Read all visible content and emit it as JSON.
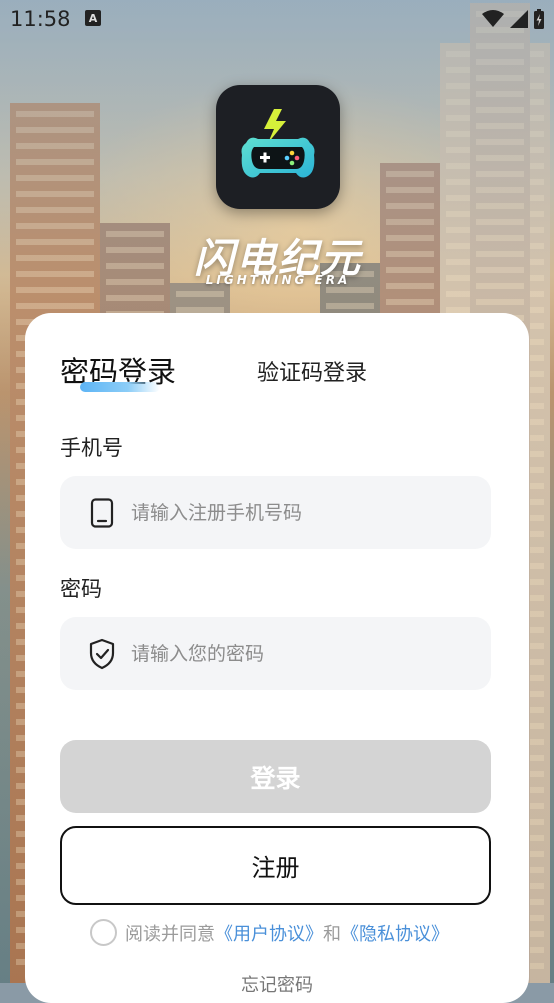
{
  "status_bar": {
    "time": "11:58",
    "notification_letter": "A",
    "icons": [
      "wifi-icon",
      "signal-icon",
      "battery-charging-icon"
    ]
  },
  "brand": {
    "name_cn": "闪电纪元",
    "name_en": "LIGHTNING ERA",
    "logo_icon": "gamepad-lightning-icon"
  },
  "login": {
    "tabs": [
      {
        "label": "密码登录",
        "active": true
      },
      {
        "label": "验证码登录",
        "active": false
      }
    ],
    "phone": {
      "label": "手机号",
      "placeholder": "请输入注册手机号码",
      "value": "",
      "icon": "phone-icon"
    },
    "password": {
      "label": "密码",
      "placeholder": "请输入您的密码",
      "value": "",
      "icon": "shield-icon"
    },
    "login_button": "登录",
    "register_button": "注册",
    "agreement": {
      "checked": false,
      "prefix": "阅读并同意",
      "user_agreement": "《用户协议》",
      "conjunction": "和",
      "privacy_agreement": "《隐私协议》"
    },
    "forgot_password": "忘记密码"
  },
  "colors": {
    "accent_underline": "#5db4f5",
    "link": "#4a90d9",
    "disabled_button": "#d4d4d4"
  }
}
